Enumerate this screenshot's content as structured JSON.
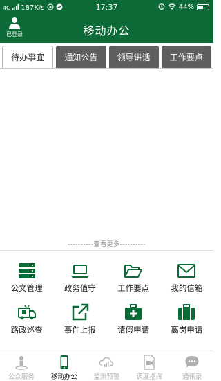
{
  "status_bar": {
    "signal": "4G",
    "speed": "187K/s",
    "time": "17:37",
    "battery": "44%"
  },
  "header": {
    "title": "移动办公",
    "login_label": "已登录"
  },
  "tabs": [
    {
      "label": "待办事宜",
      "active": true
    },
    {
      "label": "通知公告",
      "active": false
    },
    {
      "label": "领导讲话",
      "active": false
    },
    {
      "label": "工作要点",
      "active": false
    }
  ],
  "content": {
    "more_label": "----------查看更多----------"
  },
  "grid": [
    {
      "label": "公文管理",
      "icon": "server-stack-icon"
    },
    {
      "label": "政务值守",
      "icon": "laptop-icon"
    },
    {
      "label": "工作要点",
      "icon": "folder-open-icon"
    },
    {
      "label": "我的信箱",
      "icon": "envelope-icon"
    },
    {
      "label": "路政巡查",
      "icon": "patrol-truck-icon"
    },
    {
      "label": "事件上报",
      "icon": "external-link-icon"
    },
    {
      "label": "请假申请",
      "icon": "medical-kit-icon"
    },
    {
      "label": "离岗申请",
      "icon": "briefcase-icon"
    }
  ],
  "bottom_nav": [
    {
      "label": "公众服务",
      "icon": "person-pin-icon",
      "active": false
    },
    {
      "label": "移动办公",
      "icon": "mobile-phone-icon",
      "active": true
    },
    {
      "label": "监测预警",
      "icon": "cloud-signal-icon",
      "active": false
    },
    {
      "label": "调度指挥",
      "icon": "video-doc-icon",
      "active": false
    },
    {
      "label": "通讯录",
      "icon": "chat-bubble-icon",
      "active": false
    }
  ],
  "colors": {
    "brand_green": "#0b6a35",
    "tab_inactive": "#5e5e5e",
    "nav_inactive": "#b0b0b0"
  }
}
